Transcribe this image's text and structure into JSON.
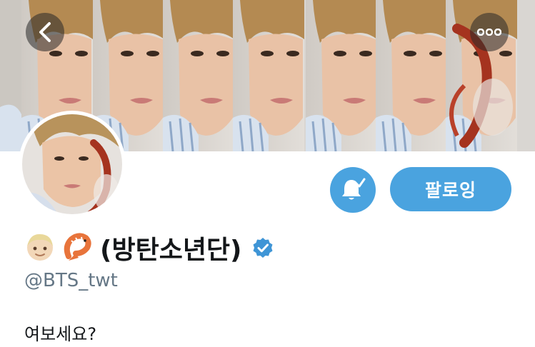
{
  "header": {
    "back_icon": "chevron-left-icon",
    "more_icon": "more-dots-icon",
    "banner_description_icon": "banner-image"
  },
  "actions": {
    "notification_icon": "bell-check-icon",
    "follow_label": "팔로잉"
  },
  "profile": {
    "emoji_1": "person-light-skin-emoji",
    "emoji_2": "shrimp-emoji",
    "display_name": "(방탄소년단)",
    "verified_icon": "verified-badge-icon",
    "handle": "@BTS_twt",
    "bio": "여보세요?"
  },
  "colors": {
    "accent": "#4aa3df",
    "text_primary": "#14171a",
    "text_secondary": "#657786",
    "verified": "#3f95d6"
  }
}
